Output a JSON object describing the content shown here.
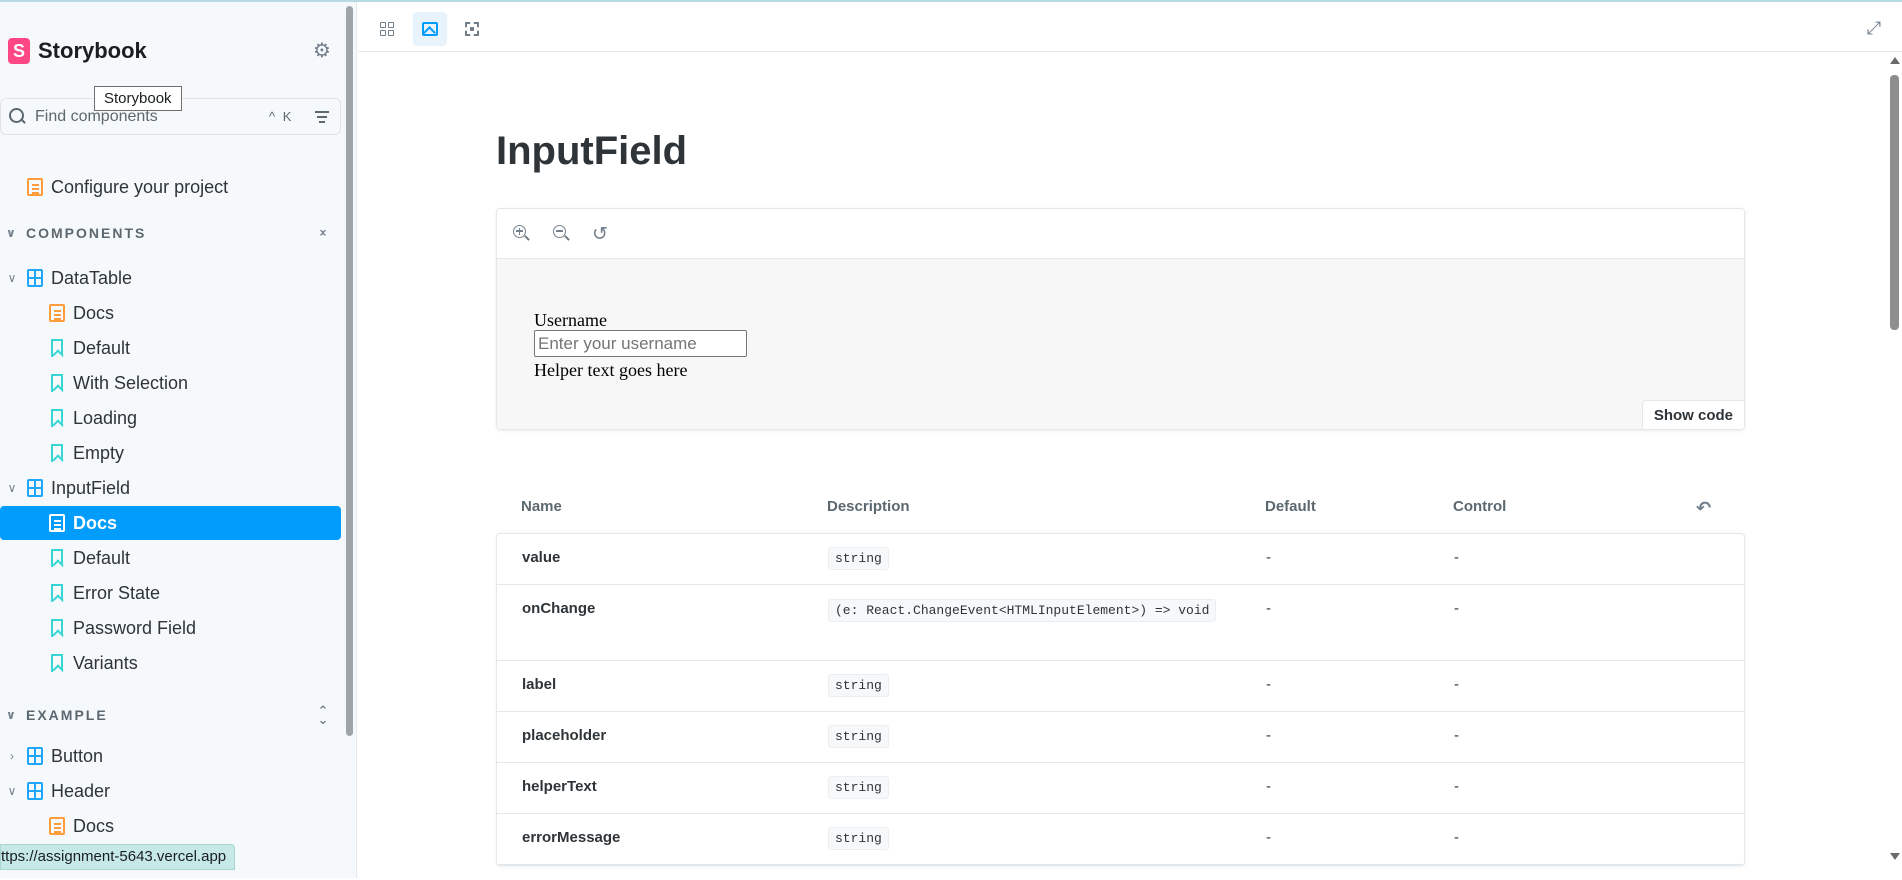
{
  "app": {
    "brand_name": "Storybook",
    "tooltip": "Storybook",
    "status_url": "ttps://assignment-5643.vercel.app"
  },
  "sidebar": {
    "search_placeholder": "Find components",
    "shortcut": "^ K",
    "configure": "Configure your project",
    "sections": [
      {
        "label": "COMPONENTS"
      },
      {
        "label": "EXAMPLE"
      }
    ],
    "items": [
      {
        "label": "DataTable",
        "icon": "component-icon"
      },
      {
        "label": "Docs",
        "icon": "docs-icon"
      },
      {
        "label": "Default",
        "icon": "story-icon"
      },
      {
        "label": "With Selection",
        "icon": "story-icon"
      },
      {
        "label": "Loading",
        "icon": "story-icon"
      },
      {
        "label": "Empty",
        "icon": "story-icon"
      },
      {
        "label": "InputField",
        "icon": "component-icon"
      },
      {
        "label": "Docs",
        "icon": "docs-icon",
        "active": true
      },
      {
        "label": "Default",
        "icon": "story-icon"
      },
      {
        "label": "Error State",
        "icon": "story-icon"
      },
      {
        "label": "Password Field",
        "icon": "story-icon"
      },
      {
        "label": "Variants",
        "icon": "story-icon"
      },
      {
        "label": "Button",
        "icon": "component-icon"
      },
      {
        "label": "Header",
        "icon": "component-icon"
      },
      {
        "label": "Docs",
        "icon": "docs-icon"
      }
    ]
  },
  "docs": {
    "title": "InputField",
    "preview": {
      "label": "Username",
      "placeholder": "Enter your username",
      "helper": "Helper text goes here",
      "show_code": "Show code"
    },
    "args_table": {
      "headers": [
        "Name",
        "Description",
        "Default",
        "Control"
      ],
      "rows": [
        {
          "name": "value",
          "type": "string",
          "default": "-",
          "control": "-"
        },
        {
          "name": "onChange",
          "type": "(e: React.ChangeEvent<HTMLInputElement>) => void",
          "default": "-",
          "control": "-"
        },
        {
          "name": "label",
          "type": "string",
          "default": "-",
          "control": "-"
        },
        {
          "name": "placeholder",
          "type": "string",
          "default": "-",
          "control": "-"
        },
        {
          "name": "helperText",
          "type": "string",
          "default": "-",
          "control": "-"
        },
        {
          "name": "errorMessage",
          "type": "string",
          "default": "-",
          "control": "-"
        }
      ]
    }
  },
  "colors": {
    "accent": "#029cfd",
    "brand": "#ff4785",
    "docs_icon": "#ff9d3b",
    "component_icon": "#1ea7fd",
    "story_icon": "#37d5d3"
  }
}
